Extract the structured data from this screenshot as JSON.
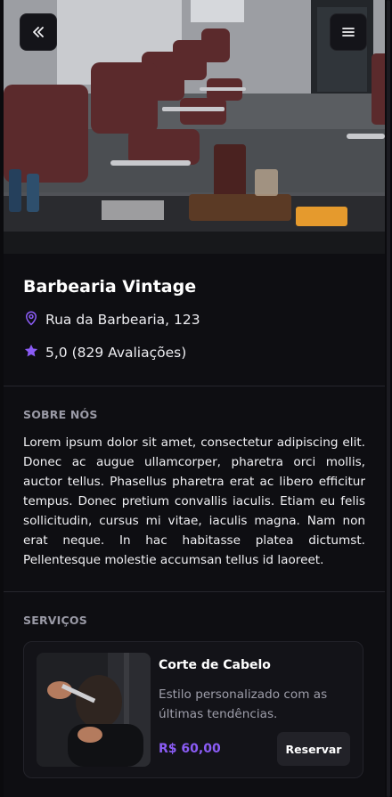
{
  "hero": {
    "image": "barbershop-interior-photo"
  },
  "shop": {
    "name": "Barbearia Vintage",
    "address": "Rua da Barbearia, 123",
    "rating": "5,0 (829 Avaliações)"
  },
  "about": {
    "title": "SOBRE NÓS",
    "text": "Lorem ipsum dolor sit amet, consectetur adipiscing elit. Donec ac augue ullamcorper, pharetra orci mollis, auctor tellus. Phasellus pharetra erat ac libero efficitur tempus. Donec pretium convallis iaculis. Etiam eu felis sollicitudin, cursus mi vitae, iaculis magna. Nam non erat neque. In hac habitasse platea dictumst. Pellentesque molestie accumsan tellus id laoreet."
  },
  "services": {
    "title": "SERVIÇOS",
    "items": [
      {
        "name": "Corte de Cabelo",
        "description": "Estilo personalizado com as últimas tendências.",
        "price": "R$ 60,00",
        "button": "Reservar"
      }
    ]
  },
  "colors": {
    "accent": "#8b5cf6",
    "background": "#0e0e12",
    "card": "#131318"
  }
}
